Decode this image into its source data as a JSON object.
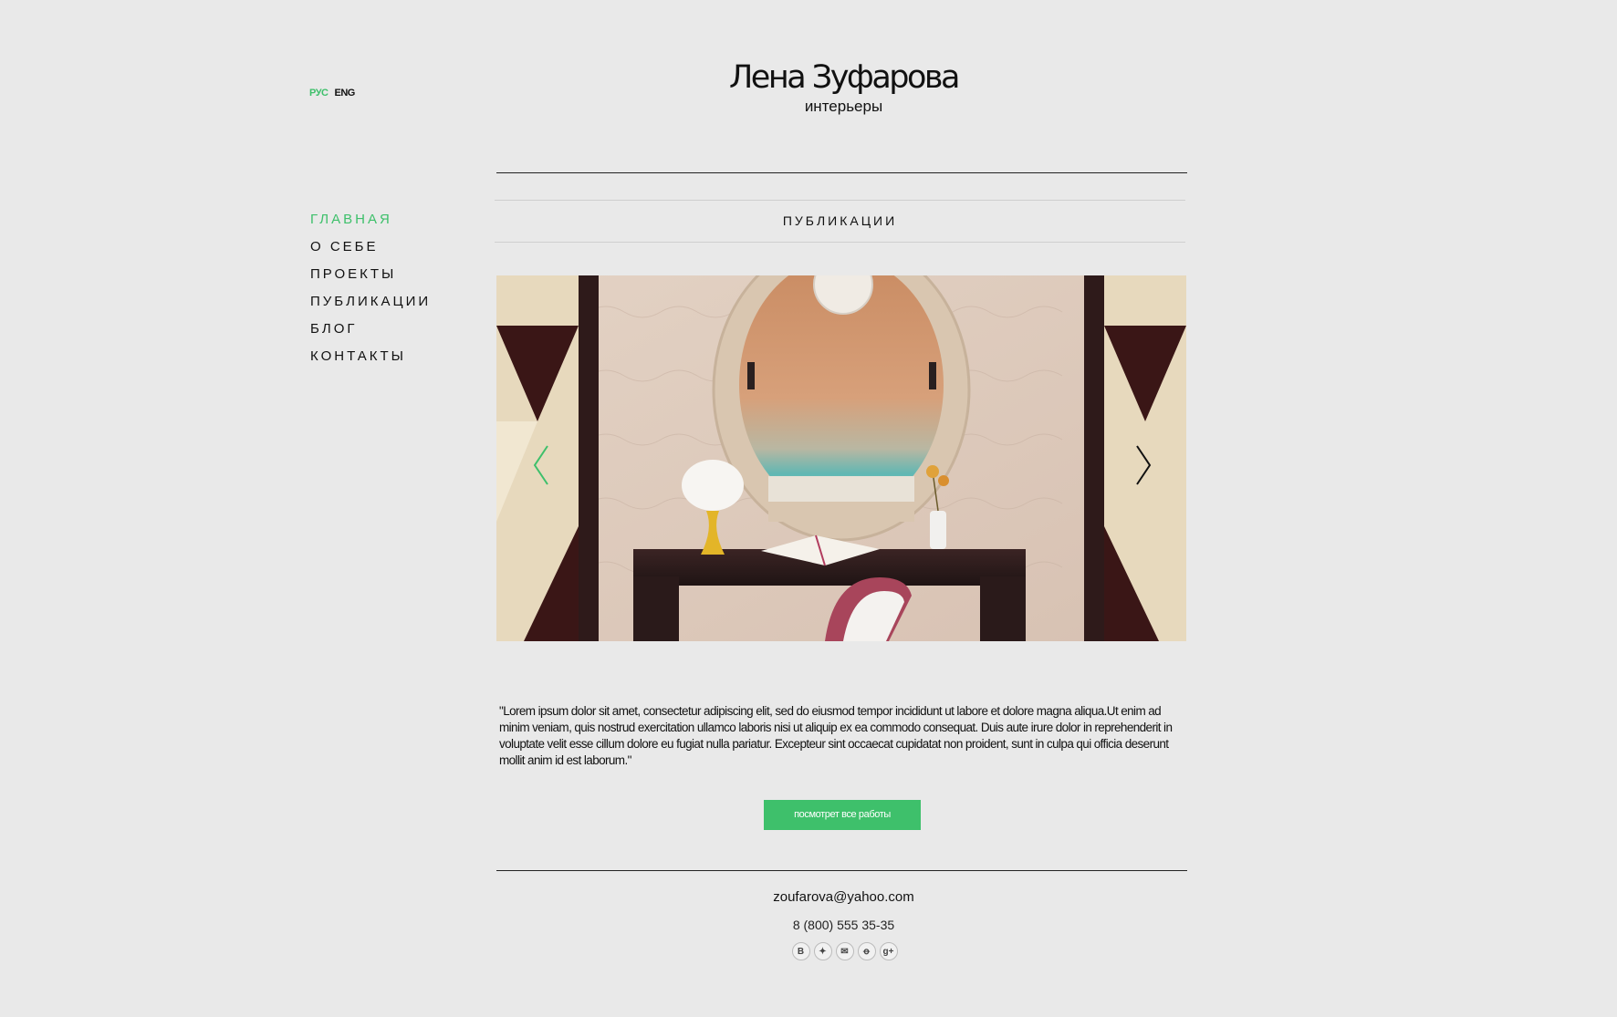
{
  "languages": [
    {
      "label": "РУС",
      "active": true
    },
    {
      "label": "ENG",
      "active": false
    }
  ],
  "header": {
    "title": "Лена Зуфарова",
    "subtitle": "интерьеры"
  },
  "nav": {
    "items": [
      {
        "label": "ГЛАВНАЯ",
        "active": true
      },
      {
        "label": "О СЕБЕ",
        "active": false
      },
      {
        "label": "ПРОЕКТЫ",
        "active": false
      },
      {
        "label": "ПУБЛИКАЦИИ",
        "active": false
      },
      {
        "label": "БЛОГ",
        "active": false
      },
      {
        "label": "КОНТАКТЫ",
        "active": false
      }
    ]
  },
  "section": {
    "title": "ПУБЛИКАЦИИ"
  },
  "slider": {
    "image_alt": "interior-desk-mirror-photo",
    "prev_icon": "chevron-left-icon",
    "next_icon": "chevron-right-icon"
  },
  "quote": {
    "text": "\"Lorem ipsum dolor sit amet, consectetur adipiscing elit, sed do eiusmod tempor incididunt ut labore et dolore magna aliqua.Ut enim ad minim veniam, quis nostrud exercitation ullamco laboris nisi ut aliquip ex ea commodo consequat. Duis aute irure dolor in reprehenderit in voluptate velit esse cillum dolore eu fugiat nulla pariatur. Excepteur sint occaecat cupidatat non proident, sunt in culpa qui officia deserunt mollit anim id est laborum.\""
  },
  "cta": {
    "label": "посмотрет все работы"
  },
  "contacts": {
    "email": "zoufarova@yahoo.com",
    "phone": "8 (800) 555 35-35"
  },
  "socials": [
    {
      "icon": "vk-icon",
      "glyph": "B"
    },
    {
      "icon": "twitter-icon",
      "glyph": "✦"
    },
    {
      "icon": "mail-icon",
      "glyph": "✉"
    },
    {
      "icon": "odnoklassniki-icon",
      "glyph": "ꝋ"
    },
    {
      "icon": "google-plus-icon",
      "glyph": "g+"
    }
  ],
  "colors": {
    "accent": "#3ec06b",
    "background": "#e9e9e9",
    "text": "#111111"
  }
}
